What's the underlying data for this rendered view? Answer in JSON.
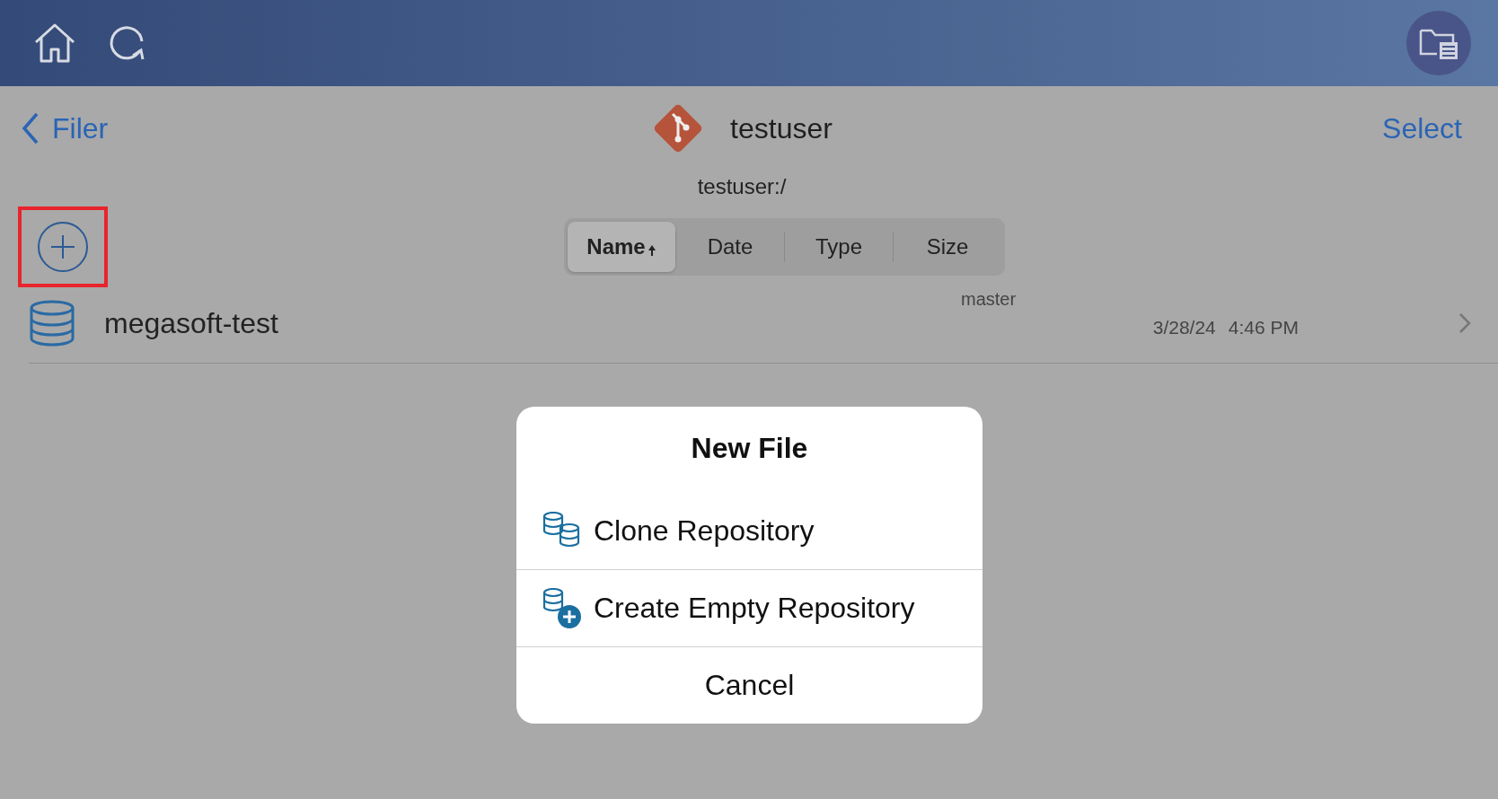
{
  "nav": {
    "back_label": "Filer",
    "title": "testuser",
    "action": "Select"
  },
  "path": "testuser:/",
  "add_button": {
    "highlighted": true
  },
  "sort_options": [
    {
      "label": "Name",
      "selected": true,
      "ascending": true
    },
    {
      "label": "Date",
      "selected": false
    },
    {
      "label": "Type",
      "selected": false
    },
    {
      "label": "Size",
      "selected": false
    }
  ],
  "files": [
    {
      "kind": "repository",
      "name": "megasoft-test",
      "branch": "master",
      "date": "3/28/24",
      "time": "4:46 PM"
    }
  ],
  "dialog": {
    "title": "New File",
    "actions": [
      {
        "kind": "clone",
        "label": "Clone Repository"
      },
      {
        "kind": "create",
        "label": "Create Empty Repository"
      },
      {
        "kind": "cancel",
        "label": "Cancel"
      }
    ]
  }
}
